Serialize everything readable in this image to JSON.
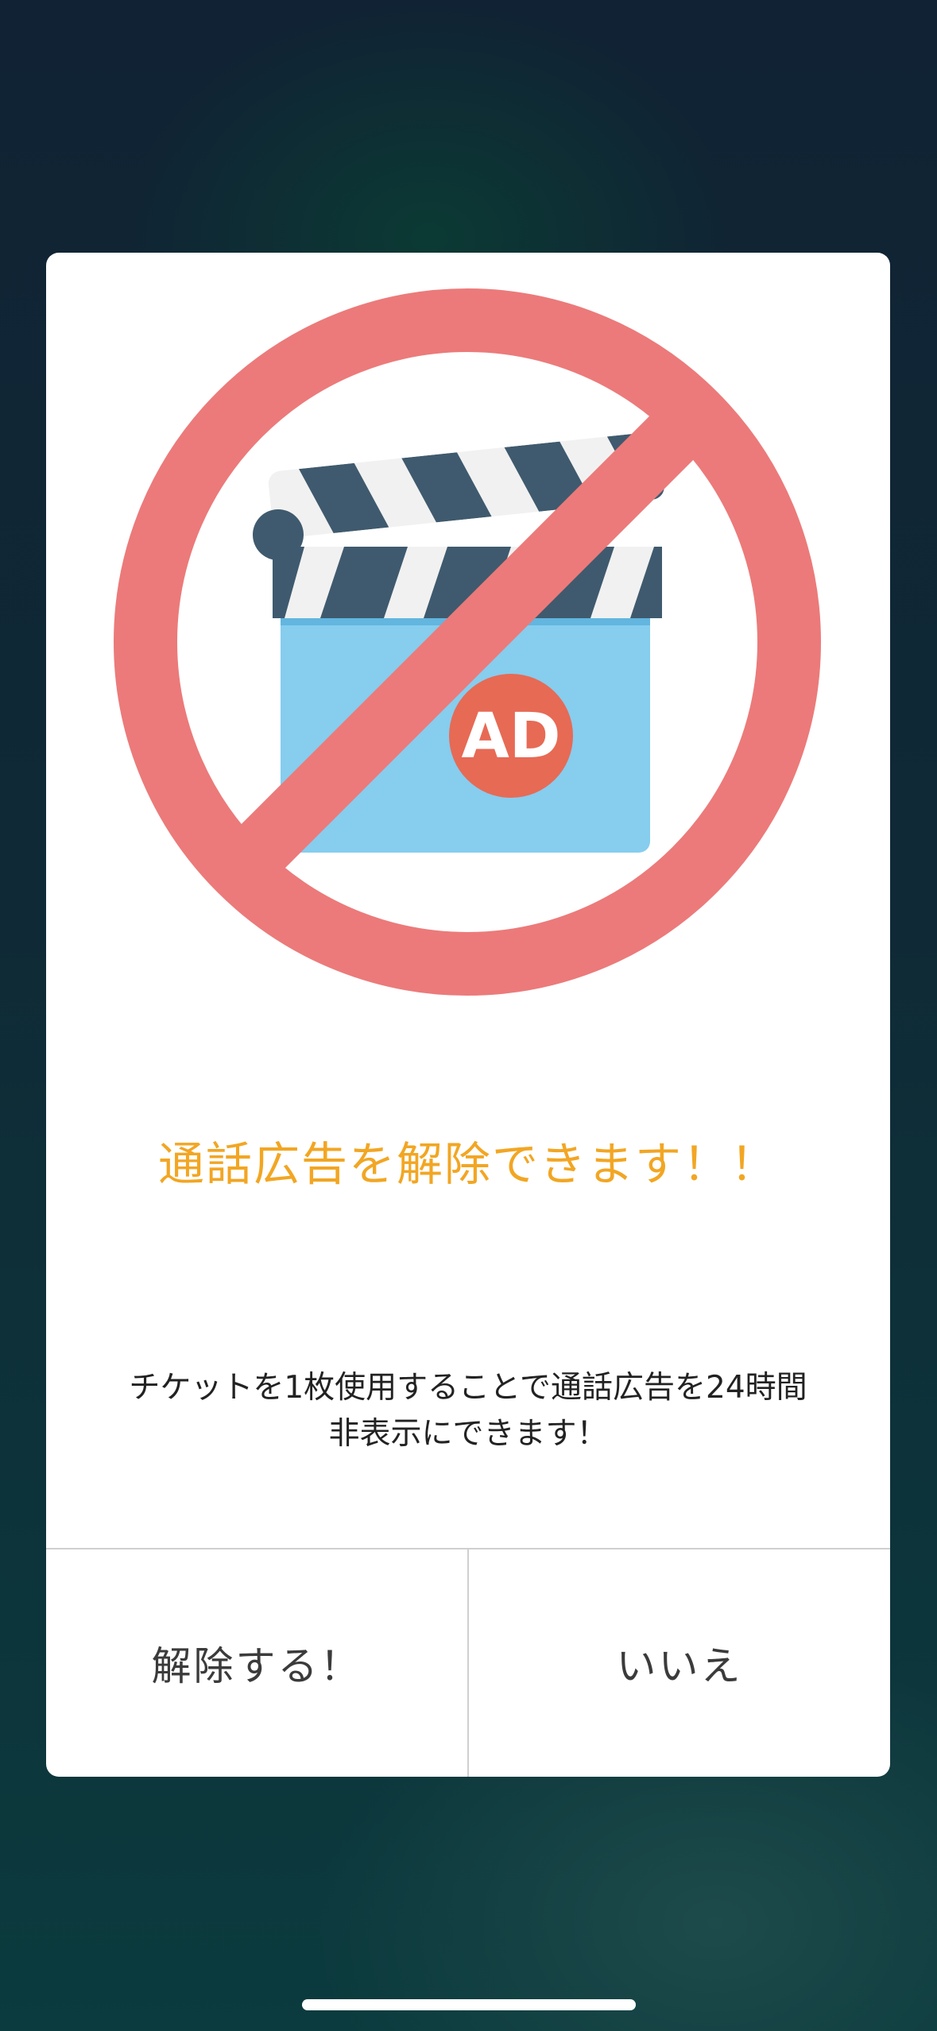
{
  "dialog": {
    "illustration_icon": "no-ads-icon",
    "illustration_badge": "AD",
    "title": "通話広告を解除できます！！",
    "message_line1": "チケットを1枚使用することで通話広告を24時間",
    "message_line2": "非表示にできます！",
    "confirm_label": "解除する！",
    "cancel_label": "いいえ"
  },
  "colors": {
    "title": "#f2a623",
    "prohibition": "#ec7a7a",
    "clapper_dark": "#3f5a6e",
    "clapper_body": "#86cdee",
    "badge": "#e76a55"
  }
}
